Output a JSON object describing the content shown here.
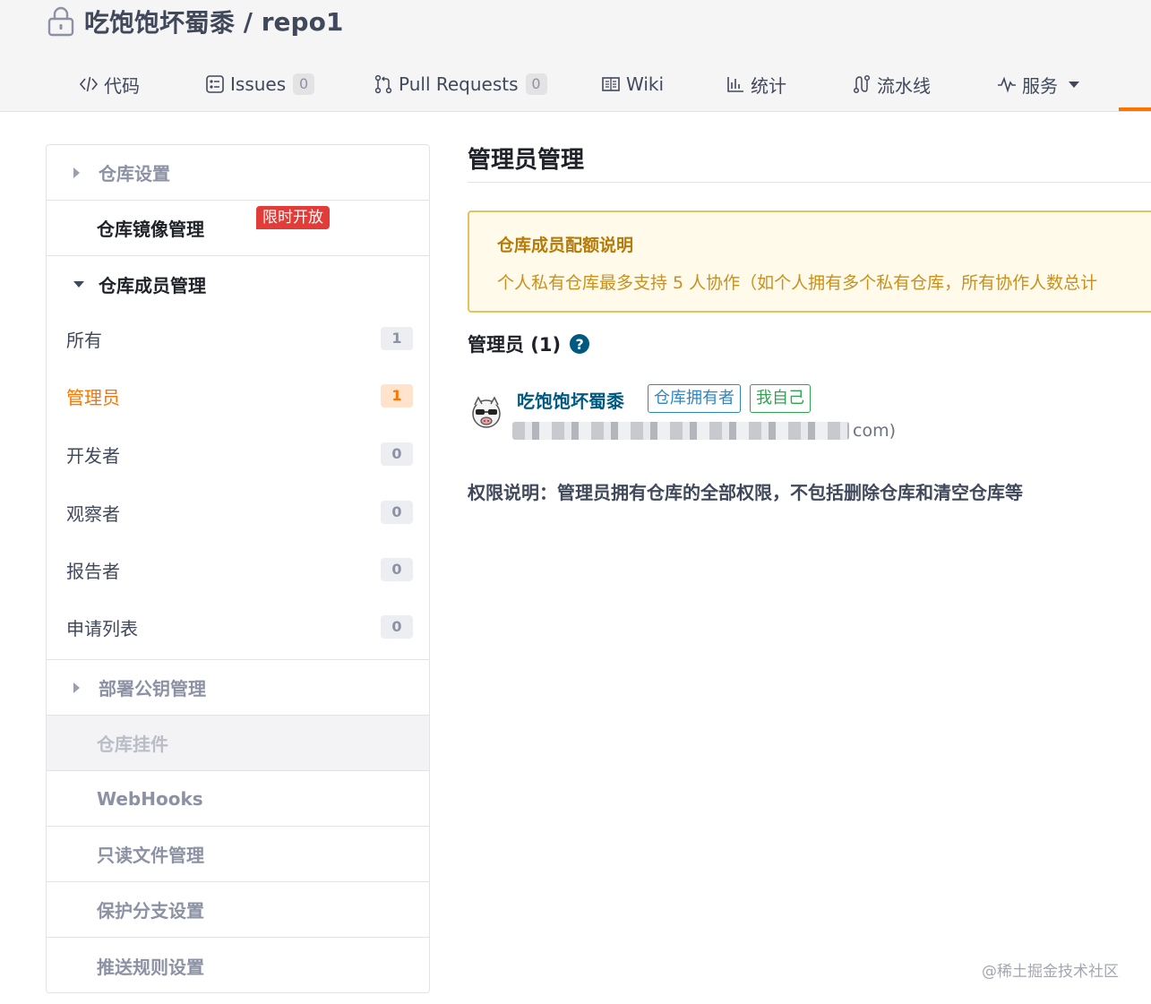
{
  "header": {
    "repo_owner": "吃饱饱坏蜀黍",
    "separator": " / ",
    "repo_name": "repo1"
  },
  "nav": {
    "tabs": [
      {
        "label": "代码",
        "icon": "code-icon"
      },
      {
        "label": "Issues",
        "icon": "issues-icon",
        "count": "0"
      },
      {
        "label": "Pull Requests",
        "icon": "pull-request-icon",
        "count": "0"
      },
      {
        "label": "Wiki",
        "icon": "wiki-icon"
      },
      {
        "label": "统计",
        "icon": "chart-icon"
      },
      {
        "label": "流水线",
        "icon": "pipeline-icon"
      },
      {
        "label": "服务",
        "icon": "pulse-icon",
        "dropdown": true
      }
    ],
    "accent_color": "#fe7300"
  },
  "sidebar": {
    "repo_settings": "仓库设置",
    "mirror_management": "仓库镜像管理",
    "mirror_badge": "限时开放",
    "member_management": "仓库成员管理",
    "member_filters": [
      {
        "label": "所有",
        "count": "1"
      },
      {
        "label": "管理员",
        "count": "1",
        "active": true
      },
      {
        "label": "开发者",
        "count": "0"
      },
      {
        "label": "观察者",
        "count": "0"
      },
      {
        "label": "报告者",
        "count": "0"
      },
      {
        "label": "申请列表",
        "count": "0"
      }
    ],
    "deploy_keys": "部署公钥管理",
    "repo_plugins": "仓库挂件",
    "webhooks": "WebHooks",
    "readonly_files": "只读文件管理",
    "protected_branches": "保护分支设置",
    "push_rules": "推送规则设置"
  },
  "main": {
    "title": "管理员管理",
    "notice": {
      "title": "仓库成员配额说明",
      "text": "个人私有仓库最多支持 5 人协作（如个人拥有多个私有仓库，所有协作人数总计"
    },
    "admins_heading": "管理员 (1)",
    "help_symbol": "?",
    "member": {
      "name": "吃饱饱坏蜀黍",
      "tag_owner": "仓库拥有者",
      "tag_self": "我自己",
      "email_suffix": "com)"
    },
    "permission_note": "权限说明：管理员拥有仓库的全部权限，不包括删除仓库和清空仓库等"
  },
  "watermark": "@稀土掘金技术社区",
  "colors": {
    "active": "#fe7300",
    "link": "#005980",
    "notice_border": "#e6c15e",
    "badge_red": "#e23c39"
  }
}
